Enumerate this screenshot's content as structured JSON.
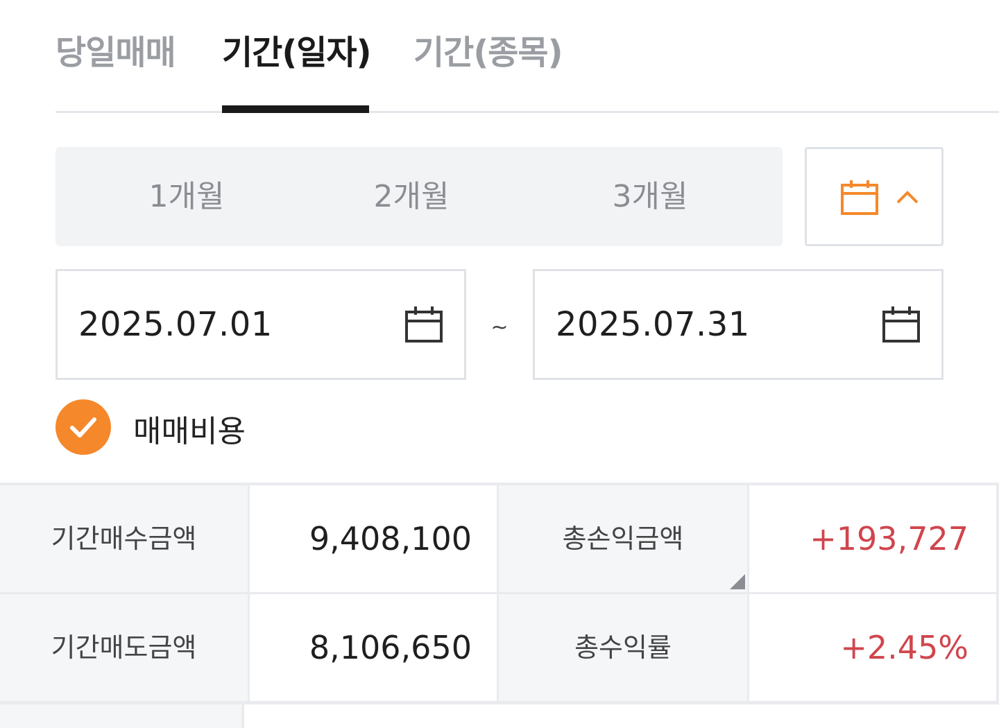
{
  "tabs": [
    {
      "label": "당일매매"
    },
    {
      "label": "기간(일자)"
    },
    {
      "label": "기간(종목)"
    }
  ],
  "active_tab": 1,
  "period_options": [
    "1개월",
    "2개월",
    "3개월"
  ],
  "calendar_toggle": {
    "icon": "calendar-icon",
    "chevron": "chevron-up-icon",
    "accent": "#f5882a"
  },
  "date_range": {
    "start": "2025.07.01",
    "separator": "~",
    "end": "2025.07.31"
  },
  "trade_cost": {
    "label": "매매비용",
    "checked": true
  },
  "summary": {
    "buy_amount_label": "기간매수금액",
    "buy_amount": "9,408,100",
    "total_pnl_label": "총손익금액",
    "total_pnl": "+193,727",
    "sell_amount_label": "기간매도금액",
    "sell_amount": "8,106,650",
    "total_return_label": "총수익률",
    "total_return": "+2.45%"
  },
  "colors": {
    "accent": "#f5882a",
    "positive": "#d0454d"
  }
}
